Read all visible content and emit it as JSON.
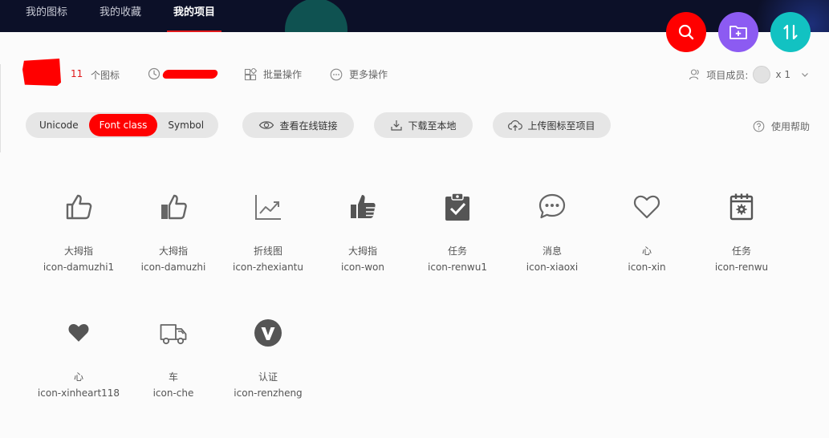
{
  "nav": {
    "tabs": [
      {
        "label": "我的图标"
      },
      {
        "label": "我的收藏"
      },
      {
        "label": "我的项目"
      }
    ],
    "fab_colors": {
      "search": "#ff0000",
      "add_folder": "#8c5bf2",
      "sort": "#12c2c2"
    }
  },
  "project": {
    "icon_count": "11",
    "icon_count_label": "个图标",
    "batch_label": "批量操作",
    "more_label": "更多操作",
    "members_label": "项目成员:",
    "members_count": "x 1"
  },
  "toolbar": {
    "formats": [
      {
        "label": "Unicode"
      },
      {
        "label": "Font class"
      },
      {
        "label": "Symbol"
      }
    ],
    "selected_format": "Font class",
    "view_link_label": "查看在线链接",
    "download_label": "下载至本地",
    "upload_label": "上传图标至项目",
    "help_label": "使用帮助"
  },
  "icons": [
    {
      "name": "大拇指",
      "class": "icon-damuzhi1",
      "icon": "thumbs-up-outline-icon"
    },
    {
      "name": "大拇指",
      "class": "icon-damuzhi",
      "icon": "thumbs-up-half-icon"
    },
    {
      "name": "折线图",
      "class": "icon-zhexiantu",
      "icon": "line-chart-icon"
    },
    {
      "name": "大拇指",
      "class": "icon-won",
      "icon": "thumbs-up-solid-icon"
    },
    {
      "name": "任务",
      "class": "icon-renwu1",
      "icon": "clipboard-check-icon"
    },
    {
      "name": "消息",
      "class": "icon-xiaoxi",
      "icon": "chat-bubble-icon"
    },
    {
      "name": "心",
      "class": "icon-xin",
      "icon": "heart-outline-icon"
    },
    {
      "name": "任务",
      "class": "icon-renwu",
      "icon": "calendar-gear-icon"
    },
    {
      "name": "心",
      "class": "icon-xinheart118",
      "icon": "heart-solid-icon"
    },
    {
      "name": "车",
      "class": "icon-che",
      "icon": "truck-icon"
    },
    {
      "name": "认证",
      "class": "icon-renzheng",
      "icon": "verified-v-icon"
    }
  ]
}
